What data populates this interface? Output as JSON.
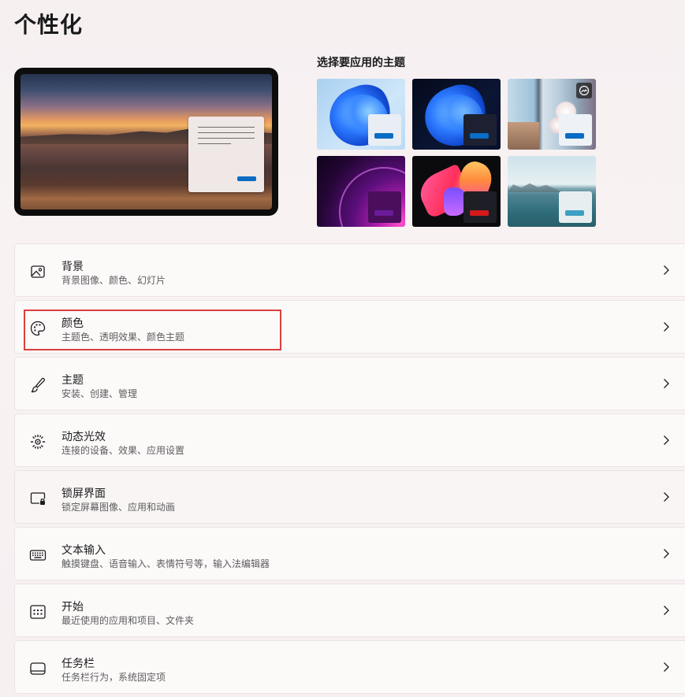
{
  "page": {
    "title": "个性化"
  },
  "themes": {
    "title": "选择要应用的主题",
    "items": [
      {
        "name": "windows-light",
        "accent": "#0a6cc4"
      },
      {
        "name": "windows-dark",
        "accent": "#0a6cc4"
      },
      {
        "name": "glow-flowers",
        "accent": "#0a6cc4"
      },
      {
        "name": "purple-glow",
        "accent": "#6a1b9a"
      },
      {
        "name": "captured-motion",
        "accent": "#d31a1a"
      },
      {
        "name": "lake",
        "accent": "#3d9fc4"
      }
    ]
  },
  "settings": [
    {
      "title": "背景",
      "desc": "背景图像、颜色、幻灯片",
      "icon": "image-icon"
    },
    {
      "title": "颜色",
      "desc": "主题色、透明效果、颜色主题",
      "icon": "palette-icon"
    },
    {
      "title": "主题",
      "desc": "安装、创建、管理",
      "icon": "brush-icon"
    },
    {
      "title": "动态光效",
      "desc": "连接的设备、效果、应用设置",
      "icon": "light-icon"
    },
    {
      "title": "锁屏界面",
      "desc": "锁定屏幕图像、应用和动画",
      "icon": "lock-screen-icon"
    },
    {
      "title": "文本输入",
      "desc": "触摸键盘、语音输入、表情符号等，输入法编辑器",
      "icon": "keyboard-icon"
    },
    {
      "title": "开始",
      "desc": "最近使用的应用和项目、文件夹",
      "icon": "start-icon"
    },
    {
      "title": "任务栏",
      "desc": "任务栏行为，系统固定项",
      "icon": "taskbar-icon"
    }
  ],
  "colors": {
    "highlight": "#d9403f",
    "accent": "#0a6cc4"
  }
}
